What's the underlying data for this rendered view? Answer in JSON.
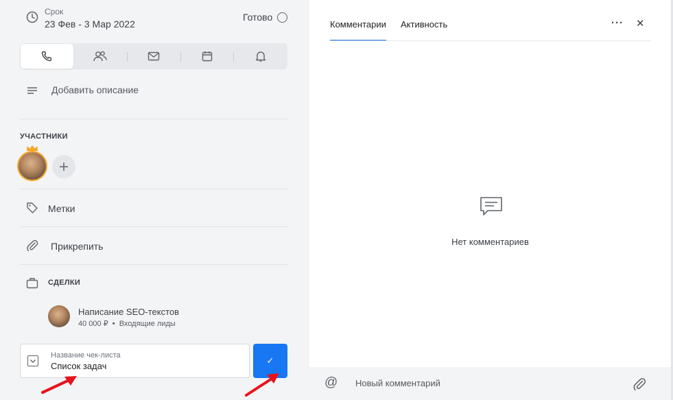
{
  "due": {
    "label": "Срок",
    "dates": "23 Фев - 3 Мар 2022",
    "done_label": "Готово"
  },
  "activity_tabs": [
    "phone-icon",
    "people-icon",
    "mail-icon",
    "calendar-icon",
    "bell-icon"
  ],
  "description": {
    "label": "Добавить описание"
  },
  "participants": {
    "title": "УЧАСТНИКИ"
  },
  "tags": {
    "label": "Метки"
  },
  "attach": {
    "label": "Прикрепить"
  },
  "deals": {
    "title": "СДЕЛКИ",
    "items": [
      {
        "name": "Написание SEO-текстов",
        "amount": "40 000 ₽",
        "stage": "Входящие лиды"
      }
    ]
  },
  "checklist": {
    "field_label": "Название чек-листа",
    "value": "Список задач",
    "confirm_glyph": "✓"
  },
  "right_panel": {
    "tabs": [
      "Комментарии",
      "Активность"
    ],
    "active_tab": 0,
    "more_glyph": "···",
    "close_glyph": "✕",
    "empty_text": "Нет комментариев",
    "comment_placeholder": "Новый комментарий",
    "mention_glyph": "@"
  },
  "colors": {
    "accent": "#1a73e8",
    "button": "#1877f2",
    "annotation_arrow": "#e8131b",
    "crown": "#f5a623"
  }
}
